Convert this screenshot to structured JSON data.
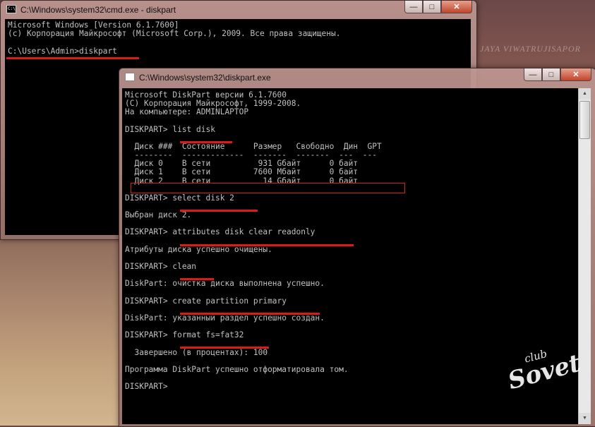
{
  "background": {
    "watermark": "JAYA VIWATRUJISAPOR"
  },
  "logo": {
    "club": "club",
    "sovet": "Sovet"
  },
  "cmd_window": {
    "title": "C:\\Windows\\system32\\cmd.exe - diskpart",
    "icon_text": "C:\\",
    "controls": {
      "minimize": "—",
      "maximize": "□",
      "close": "✕"
    },
    "lines": [
      "Microsoft Windows [Version 6.1.7600]",
      "(c) Корпорация Майкрософт (Microsoft Corp.), 2009. Все права защищены.",
      "",
      "C:\\Users\\Admin>diskpart"
    ]
  },
  "diskpart_window": {
    "title": "C:\\Windows\\system32\\diskpart.exe",
    "controls": {
      "minimize": "—",
      "maximize": "□",
      "close": "✕"
    },
    "lines": [
      "Microsoft DiskPart версии 6.1.7600",
      "(C) Корпорация Майкрософт, 1999-2008.",
      "На компьютере: ADMINLAPTOP",
      "",
      "DISKPART> list disk",
      "",
      "  Диск ###  Состояние      Размер   Свободно  Дин  GPT",
      "  --------  -------------  -------  -------  ---  ---",
      "  Диск 0    В сети          931 Gбайт      0 байт",
      "  Диск 1    В сети         7600 Mбайт      0 байт",
      "  Диск 2    В сети           14 Gбайт      0 байт",
      "",
      "DISKPART> select disk 2",
      "",
      "Выбран диск 2.",
      "",
      "DISKPART> attributes disk clear readonly",
      "",
      "Атрибуты диска успешно очищены.",
      "",
      "DISKPART> clean",
      "",
      "DiskPart: очистка диска выполнена успешно.",
      "",
      "DISKPART> create partition primary",
      "",
      "DiskPart: указанный раздел успешно создан.",
      "",
      "DISKPART> format fs=fat32",
      "",
      "  Завершено (в процентах): 100",
      "",
      "Программа DiskPart успешно отформатировала том.",
      "",
      "DISKPART>"
    ]
  }
}
